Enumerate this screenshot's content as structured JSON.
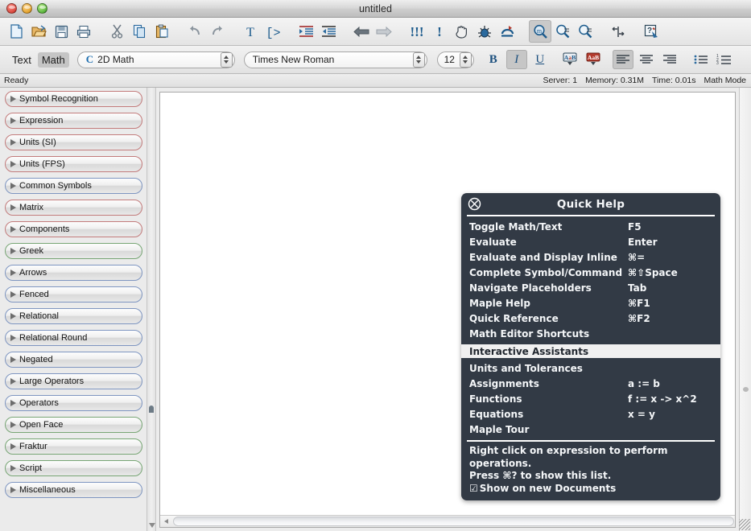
{
  "window": {
    "title": "untitled",
    "controls": [
      "close",
      "minimize",
      "zoom"
    ]
  },
  "toolbar": {
    "items": [
      {
        "name": "new-document-icon",
        "tip": "New"
      },
      {
        "name": "open-document-icon",
        "tip": "Open"
      },
      {
        "name": "save-icon",
        "tip": "Save"
      },
      {
        "name": "print-icon",
        "tip": "Print"
      },
      {
        "name": "cut-icon",
        "tip": "Cut"
      },
      {
        "name": "copy-icon",
        "tip": "Copy"
      },
      {
        "name": "paste-icon",
        "tip": "Paste"
      },
      {
        "name": "undo-icon",
        "tip": "Undo"
      },
      {
        "name": "redo-icon",
        "tip": "Redo"
      },
      {
        "name": "text-mode-icon",
        "tip": "Text"
      },
      {
        "name": "math-prompt-icon",
        "tip": "Math Input"
      },
      {
        "name": "indent-in-icon",
        "tip": "Indent"
      },
      {
        "name": "indent-out-icon",
        "tip": "Outdent"
      },
      {
        "name": "back-arrow-icon",
        "tip": "Back"
      },
      {
        "name": "forward-arrow-icon",
        "tip": "Forward"
      },
      {
        "name": "execute-worksheet-icon",
        "tip": "Execute Worksheet"
      },
      {
        "name": "execute-icon",
        "tip": "Execute"
      },
      {
        "name": "stop-icon",
        "tip": "Stop"
      },
      {
        "name": "debug-icon",
        "tip": "Debug"
      },
      {
        "name": "restart-icon",
        "tip": "Restart"
      },
      {
        "name": "zoom-100-icon",
        "tip": "Zoom 100%"
      },
      {
        "name": "zoom-out-icon",
        "tip": "Zoom Out"
      },
      {
        "name": "zoom-in-icon",
        "tip": "Zoom In"
      },
      {
        "name": "tab-toggle-icon",
        "tip": "Tab"
      },
      {
        "name": "help-icon",
        "tip": "Help"
      }
    ]
  },
  "formatbar": {
    "text_label": "Text",
    "math_label": "Math",
    "style_value": "2D Math",
    "style_glyph": "C",
    "font_value": "Times New Roman",
    "size_value": "12",
    "bold_label": "B",
    "italic_label": "I",
    "underline_label": "U",
    "highlight_icon": "text-color-icon",
    "background_icon": "text-highlight-icon",
    "align_left_icon": "align-left-icon",
    "align_center_icon": "align-center-icon",
    "align_right_icon": "align-right-icon",
    "bullet_list_icon": "bullet-list-icon",
    "numbered_list_icon": "numbered-list-icon"
  },
  "statusbar": {
    "left": "Ready",
    "server": "Server: 1",
    "memory": "Memory: 0.31M",
    "time": "Time: 0.01s",
    "mode": "Math Mode"
  },
  "palette": {
    "items": [
      {
        "label": "Symbol Recognition",
        "accent": "red"
      },
      {
        "label": "Expression",
        "accent": "red"
      },
      {
        "label": "Units (SI)",
        "accent": "red"
      },
      {
        "label": "Units (FPS)",
        "accent": "red"
      },
      {
        "label": "Common Symbols",
        "accent": "blue"
      },
      {
        "label": "Matrix",
        "accent": "red"
      },
      {
        "label": "Components",
        "accent": "red"
      },
      {
        "label": "Greek",
        "accent": "green"
      },
      {
        "label": "Arrows",
        "accent": "blue"
      },
      {
        "label": "Fenced",
        "accent": "blue"
      },
      {
        "label": "Relational",
        "accent": "blue"
      },
      {
        "label": "Relational Round",
        "accent": "blue"
      },
      {
        "label": "Negated",
        "accent": "blue"
      },
      {
        "label": "Large Operators",
        "accent": "blue"
      },
      {
        "label": "Operators",
        "accent": "blue"
      },
      {
        "label": "Open Face",
        "accent": "green"
      },
      {
        "label": "Fraktur",
        "accent": "green"
      },
      {
        "label": "Script",
        "accent": "green"
      },
      {
        "label": "Miscellaneous",
        "accent": "blue"
      }
    ]
  },
  "quick_help": {
    "title": "Quick Help",
    "close_icon": "close-circle-icon",
    "shortcuts": [
      {
        "label": "Toggle Math/Text",
        "key": "F5"
      },
      {
        "label": "Evaluate",
        "key": "Enter"
      },
      {
        "label": "Evaluate and Display Inline",
        "key": "⌘="
      },
      {
        "label": "Complete Symbol/Command",
        "key": "⌘⇧Space"
      },
      {
        "label": "Navigate Placeholders",
        "key": "Tab"
      },
      {
        "label": "Maple Help",
        "key": "⌘F1"
      },
      {
        "label": "Quick Reference",
        "key": "⌘F2"
      },
      {
        "label": "Math Editor Shortcuts",
        "key": ""
      }
    ],
    "section_header": "Interactive Assistants",
    "assistants": [
      {
        "label": "Units and Tolerances",
        "key": ""
      },
      {
        "label": "Assignments",
        "key": "a := b"
      },
      {
        "label": "Functions",
        "key": "f := x -> x^2"
      },
      {
        "label": "Equations",
        "key": "x = y"
      },
      {
        "label": "Maple Tour",
        "key": ""
      }
    ],
    "footer_line1": "Right click on expression to perform operations.",
    "footer_line2": "Press ⌘? to show this list.",
    "footer_checkbox": "☑",
    "footer_checkbox_label": "Show on new Documents"
  },
  "colors": {
    "panel_bg": "#323a45",
    "accent_red": "#c27b7b",
    "accent_blue": "#7e95c0",
    "accent_green": "#77a574",
    "icon_blue": "#1b5a8c"
  }
}
